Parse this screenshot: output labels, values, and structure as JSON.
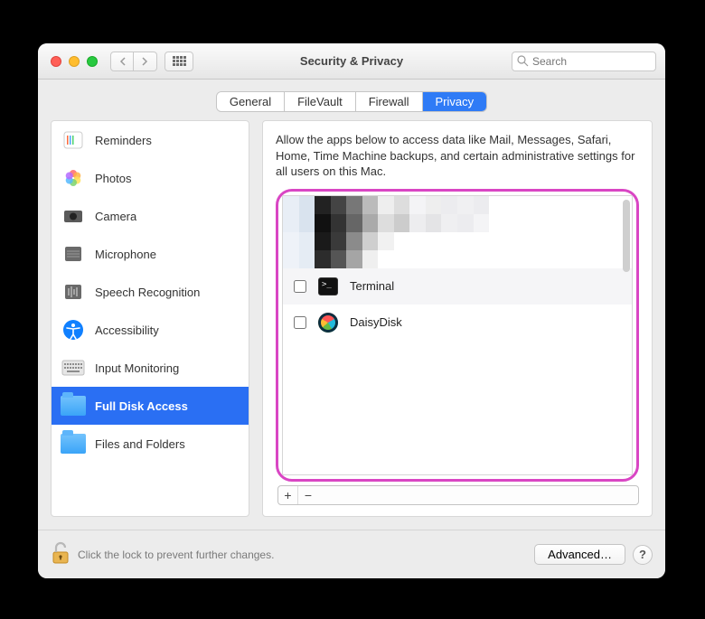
{
  "window": {
    "title": "Security & Privacy"
  },
  "search": {
    "placeholder": "Search",
    "value": ""
  },
  "tabs": [
    "General",
    "FileVault",
    "Firewall",
    "Privacy"
  ],
  "active_tab_index": 3,
  "sidebar": {
    "items": [
      {
        "label": "Reminders",
        "icon": "reminders-icon"
      },
      {
        "label": "Photos",
        "icon": "photos-icon"
      },
      {
        "label": "Camera",
        "icon": "camera-icon"
      },
      {
        "label": "Microphone",
        "icon": "microphone-icon"
      },
      {
        "label": "Speech Recognition",
        "icon": "speech-icon"
      },
      {
        "label": "Accessibility",
        "icon": "accessibility-icon"
      },
      {
        "label": "Input Monitoring",
        "icon": "keyboard-icon"
      },
      {
        "label": "Full Disk Access",
        "icon": "folder-icon",
        "selected": true
      },
      {
        "label": "Files and Folders",
        "icon": "folder-icon"
      }
    ]
  },
  "detail": {
    "description": "Allow the apps below to access data like Mail, Messages, Safari, Home, Time Machine backups, and certain administrative settings for all users on this Mac.",
    "apps": [
      {
        "name": "",
        "checked": false,
        "redacted": true
      },
      {
        "name": "",
        "checked": false,
        "redacted": true
      },
      {
        "name": "Terminal",
        "checked": false,
        "icon": "terminal"
      },
      {
        "name": "DaisyDisk",
        "checked": false,
        "icon": "daisydisk"
      }
    ],
    "add_label": "+",
    "remove_label": "−"
  },
  "footer": {
    "lock_text": "Click the lock to prevent further changes.",
    "advanced_label": "Advanced…",
    "help_label": "?"
  },
  "colors": {
    "accent": "#2f7bf6",
    "highlight_ring": "#d946c4"
  }
}
